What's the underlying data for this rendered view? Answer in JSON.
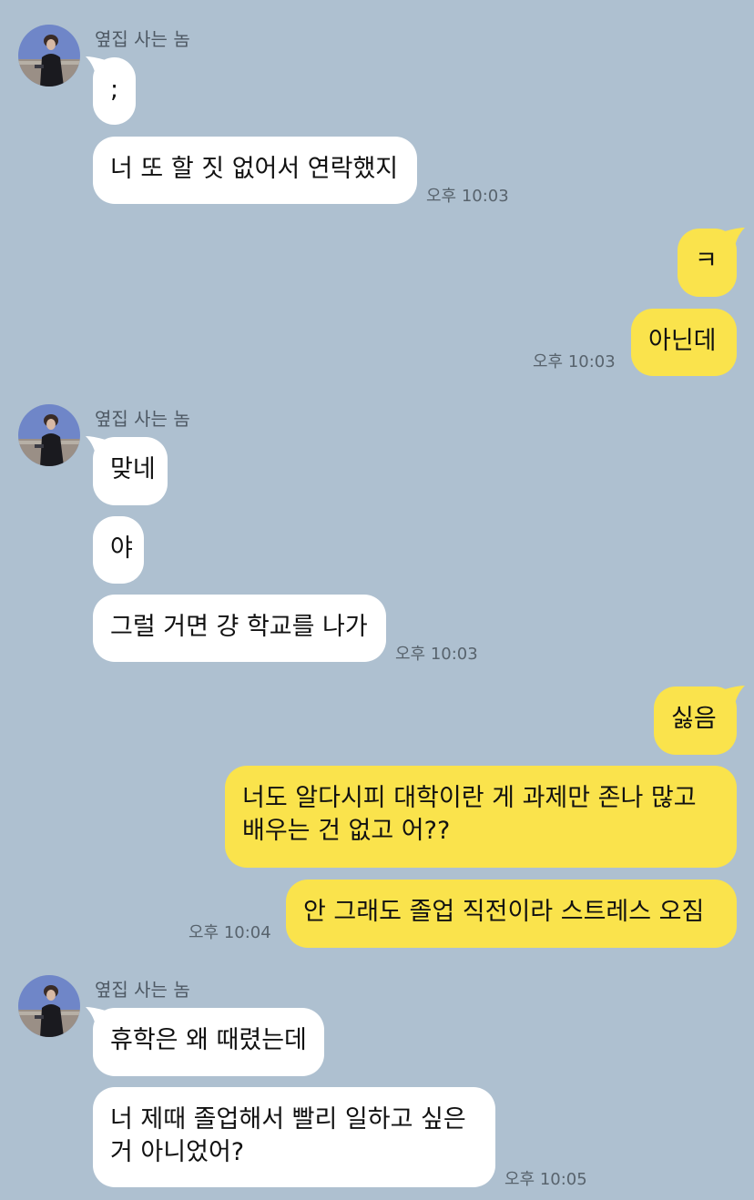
{
  "chat": {
    "sender_name": "옆집 사는 놈",
    "avatar_icon": "profile-photo",
    "colors": {
      "background": "#aec0d0",
      "incoming_bubble": "#ffffff",
      "outgoing_bubble": "#fae34c"
    },
    "groups": [
      {
        "direction": "incoming",
        "sender": "옆집 사는 놈",
        "messages": [
          ";",
          "너 또 할 짓 없어서 연락했지"
        ],
        "time": "오후 10:03"
      },
      {
        "direction": "outgoing",
        "messages": [
          "ㅋ",
          "아닌데"
        ],
        "time": "오후 10:03"
      },
      {
        "direction": "incoming",
        "sender": "옆집 사는 놈",
        "messages": [
          "맞네",
          "야",
          "그럴 거면 걍 학교를 나가"
        ],
        "time": "오후 10:03"
      },
      {
        "direction": "outgoing",
        "messages": [
          "싫음",
          "너도 알다시피 대학이란 게 과제만 존나 많고\n배우는 건 없고 어??",
          "안 그래도 졸업 직전이라 스트레스 오짐"
        ],
        "time": "오후 10:04"
      },
      {
        "direction": "incoming",
        "sender": "옆집 사는 놈",
        "messages": [
          "휴학은 왜 때렸는데",
          "너 제때 졸업해서 빨리 일하고 싶은\n거 아니었어?"
        ],
        "time": "오후 10:05"
      }
    ]
  }
}
